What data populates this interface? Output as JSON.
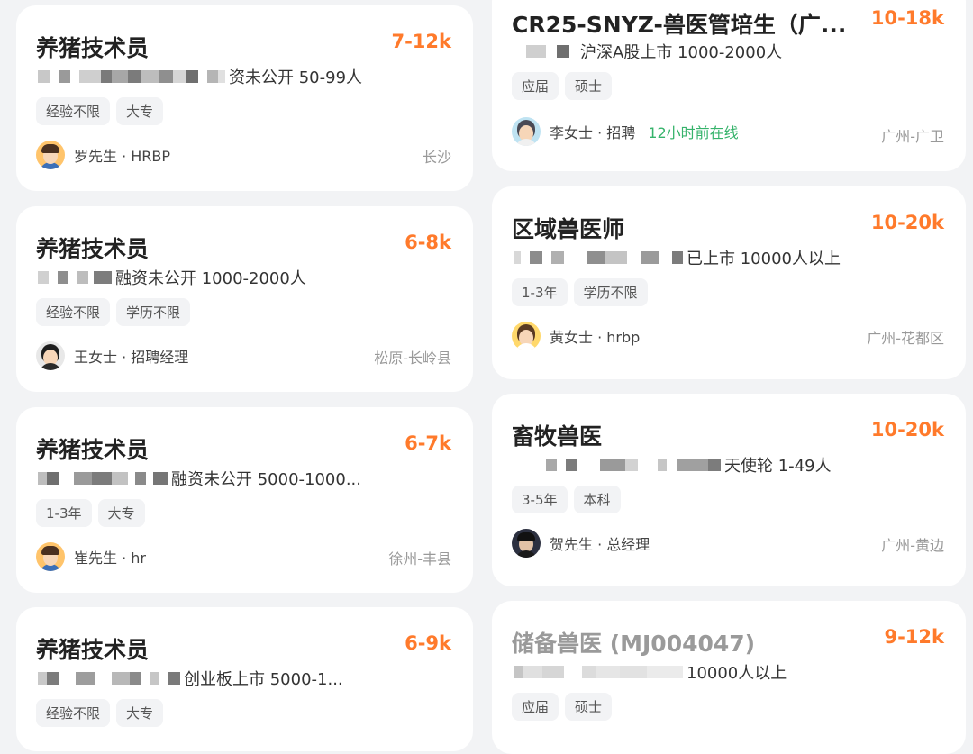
{
  "jobs_left": [
    {
      "title": "养猪技术员",
      "salary": "7-12k",
      "company_text": "资未公开  50-99人",
      "tags": [
        "经验不限",
        "大专"
      ],
      "recruiter": "罗先生 · HRBP",
      "location": "长沙",
      "avatar": "male-avatar-icon"
    },
    {
      "title": "养猪技术员",
      "salary": "6-8k",
      "company_text": "融资未公开  1000-2000人",
      "tags": [
        "经验不限",
        "学历不限"
      ],
      "recruiter": "王女士 · 招聘经理",
      "location": "松原-长岭县",
      "avatar": "female-avatar-icon"
    },
    {
      "title": "养猪技术员",
      "salary": "6-7k",
      "company_text": "融资未公开  5000-1000...",
      "tags": [
        "1-3年",
        "大专"
      ],
      "recruiter": "崔先生 · hr",
      "location": "徐州-丰县",
      "avatar": "male-avatar-icon"
    },
    {
      "title": "养猪技术员",
      "salary": "6-9k",
      "company_text": "创业板上市  5000-1...",
      "tags": [
        "经验不限",
        "大专"
      ],
      "recruiter": "",
      "location": "",
      "avatar": ""
    }
  ],
  "jobs_right": [
    {
      "title": "CR25-SNYZ-兽医管培生（广...",
      "salary": "10-18k",
      "company_text": "沪深A股上市  1000-2000人",
      "tags": [
        "应届",
        "硕士"
      ],
      "recruiter": "李女士 · 招聘",
      "online": "12小时前在线",
      "location": "广州-广卫",
      "avatar": "female-avatar-icon"
    },
    {
      "title": "区域兽医师",
      "salary": "10-20k",
      "company_text": "已上市  10000人以上",
      "tags": [
        "1-3年",
        "学历不限"
      ],
      "recruiter": "黄女士 · hrbp",
      "location": "广州-花都区",
      "avatar": "female-avatar-icon"
    },
    {
      "title": "畜牧兽医",
      "salary": "10-20k",
      "company_text": "天使轮  1-49人",
      "tags": [
        "3-5年",
        "本科"
      ],
      "recruiter": "贺先生 · 总经理",
      "location": "广州-黄边",
      "avatar": "male-avatar-icon"
    },
    {
      "title": "储备兽医 (MJ004047)",
      "salary": "9-12k",
      "company_text": "10000人以上",
      "tags": [
        "应届",
        "硕士"
      ],
      "recruiter": "",
      "location": "",
      "avatar": ""
    }
  ],
  "colors": {
    "background": "#f2f3f5",
    "card": "#ffffff",
    "salary": "#ff7a2b",
    "online": "#36b36b",
    "tag_bg": "#f2f3f5"
  }
}
